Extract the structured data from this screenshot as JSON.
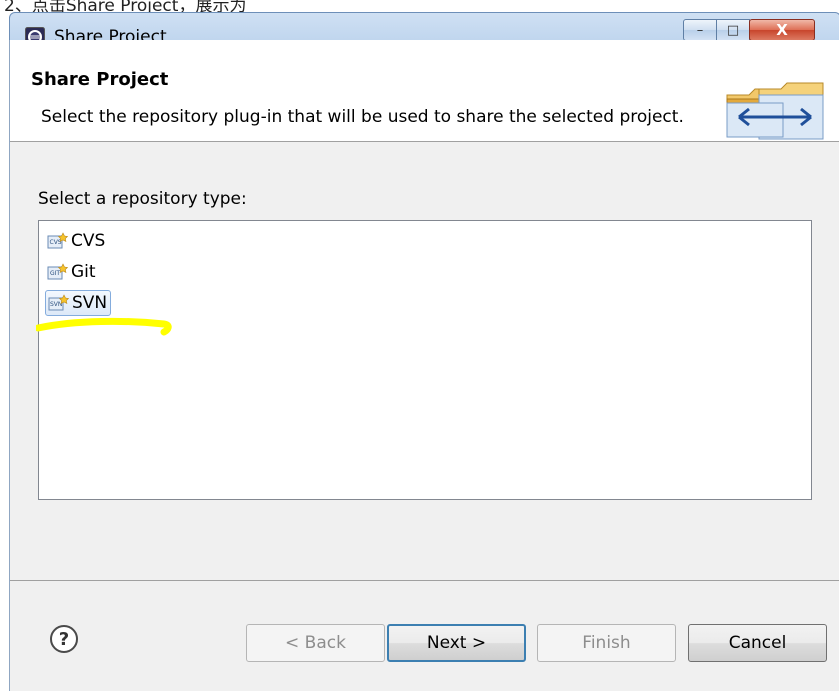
{
  "page_caption_partial": "2、点击Share Project，展示为",
  "window": {
    "title": "Share Project",
    "controls": {
      "minimize": "–",
      "maximize": "□",
      "close": "X"
    }
  },
  "header": {
    "title": "Share Project",
    "description": "Select the repository plug-in that will be used to share the selected project."
  },
  "repository": {
    "label": "Select a repository type:",
    "items": [
      {
        "label": "CVS",
        "icon": "cvs-icon",
        "selected": false
      },
      {
        "label": "Git",
        "icon": "git-icon",
        "selected": false
      },
      {
        "label": "SVN",
        "icon": "svn-icon",
        "selected": true
      }
    ]
  },
  "buttons": {
    "back": "< Back",
    "next": "Next >",
    "finish": "Finish",
    "cancel": "Cancel"
  },
  "colors": {
    "highlight": "#ffff00",
    "title_bar": "#b9d1ec",
    "close_button": "#c8452c"
  }
}
